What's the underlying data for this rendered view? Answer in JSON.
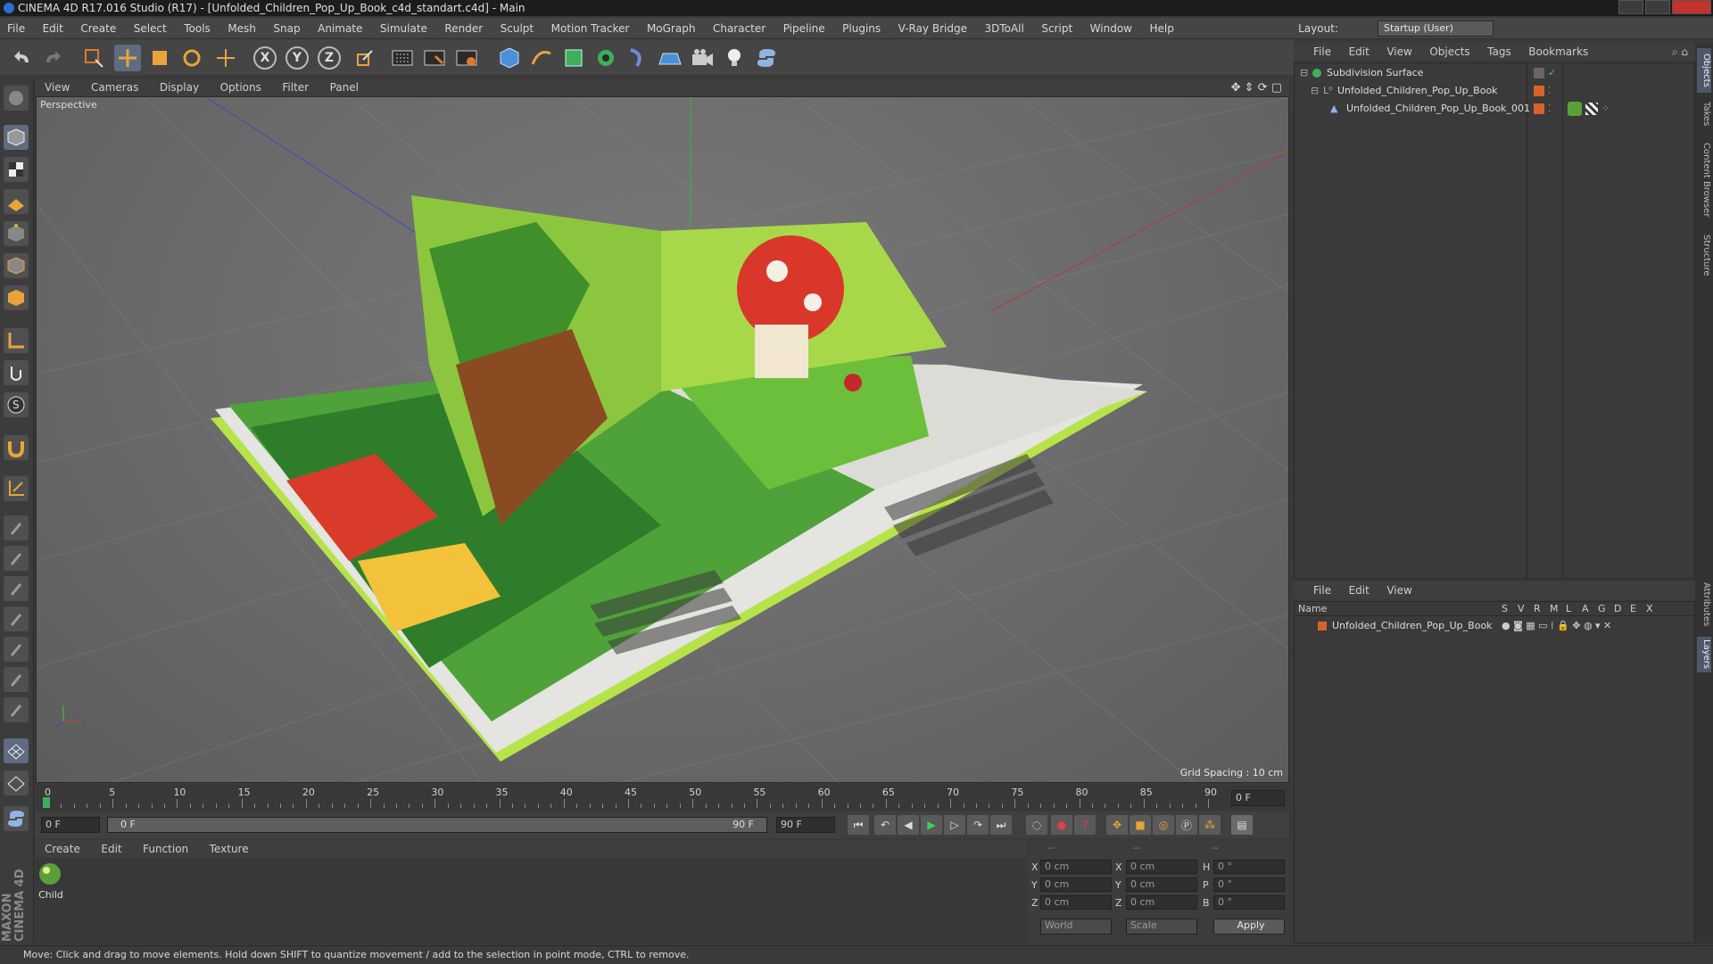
{
  "window": {
    "title": "CINEMA 4D R17.016 Studio (R17) - [Unfolded_Children_Pop_Up_Book_c4d_standart.c4d] - Main"
  },
  "menubar": {
    "items": [
      "File",
      "Edit",
      "Create",
      "Select",
      "Tools",
      "Mesh",
      "Snap",
      "Animate",
      "Simulate",
      "Render",
      "Sculpt",
      "Motion Tracker",
      "MoGraph",
      "Character",
      "Pipeline",
      "Plugins",
      "V-Ray Bridge",
      "3DToAll",
      "Script",
      "Window",
      "Help"
    ],
    "layout_label": "Layout:",
    "layout_value": "Startup (User)"
  },
  "toolbar": {
    "axis_x": "X",
    "axis_y": "Y",
    "axis_z": "Z"
  },
  "viewport": {
    "menu": [
      "View",
      "Cameras",
      "Display",
      "Options",
      "Filter",
      "Panel"
    ],
    "label": "Perspective",
    "grid_spacing": "Grid Spacing : 10 cm"
  },
  "timeline": {
    "ticks": [
      "0",
      "5",
      "10",
      "15",
      "20",
      "25",
      "30",
      "35",
      "40",
      "45",
      "50",
      "55",
      "60",
      "65",
      "70",
      "75",
      "80",
      "85",
      "90"
    ],
    "current_frame": "0 F"
  },
  "transport": {
    "start_frame": "0 F",
    "range_start": "0 F",
    "range_end": "90 F",
    "end_frame": "90 F"
  },
  "materials": {
    "menu": [
      "Create",
      "Edit",
      "Function",
      "Texture"
    ],
    "items": [
      {
        "name": "Child"
      }
    ]
  },
  "coordinates": {
    "header_1": "--",
    "header_2": "--",
    "header_3": "--",
    "pos_labels": [
      "X",
      "Y",
      "Z"
    ],
    "size_labels": [
      "X",
      "Y",
      "Z"
    ],
    "rot_labels": [
      "H",
      "P",
      "B"
    ],
    "pos_values": [
      "0 cm",
      "0 cm",
      "0 cm"
    ],
    "size_values": [
      "0 cm",
      "0 cm",
      "0 cm"
    ],
    "rot_values": [
      "0 °",
      "0 °",
      "0 °"
    ],
    "world_select": "World",
    "scale_select": "Scale",
    "apply_label": "Apply"
  },
  "objects": {
    "menu": [
      "File",
      "Edit",
      "View",
      "Objects",
      "Tags",
      "Bookmarks"
    ],
    "tree": [
      {
        "name": "Subdivision Surface"
      },
      {
        "name": "Unfolded_Children_Pop_Up_Book"
      },
      {
        "name": "Unfolded_Children_Pop_Up_Book_001"
      }
    ]
  },
  "layers": {
    "menu": [
      "File",
      "Edit",
      "View"
    ],
    "header_name": "Name",
    "header_cols": [
      "S",
      "V",
      "R",
      "M",
      "L",
      "A",
      "G",
      "D",
      "E",
      "X"
    ],
    "rows": [
      {
        "name": "Unfolded_Children_Pop_Up_Book"
      }
    ]
  },
  "side_tabs": [
    "Objects",
    "Takes",
    "Content Browser",
    "Structure",
    "Attributes",
    "Layers"
  ],
  "status": {
    "text": "Move: Click and drag to move elements. Hold down SHIFT to quantize movement / add to the selection in point mode, CTRL to remove."
  },
  "branding": {
    "maxon": "MAXON",
    "c4d": "CINEMA 4D"
  },
  "colors": {
    "accent_orange": "#e07a2a",
    "layer_swatch": "#d9622b",
    "book_green": "#b7e34a"
  }
}
